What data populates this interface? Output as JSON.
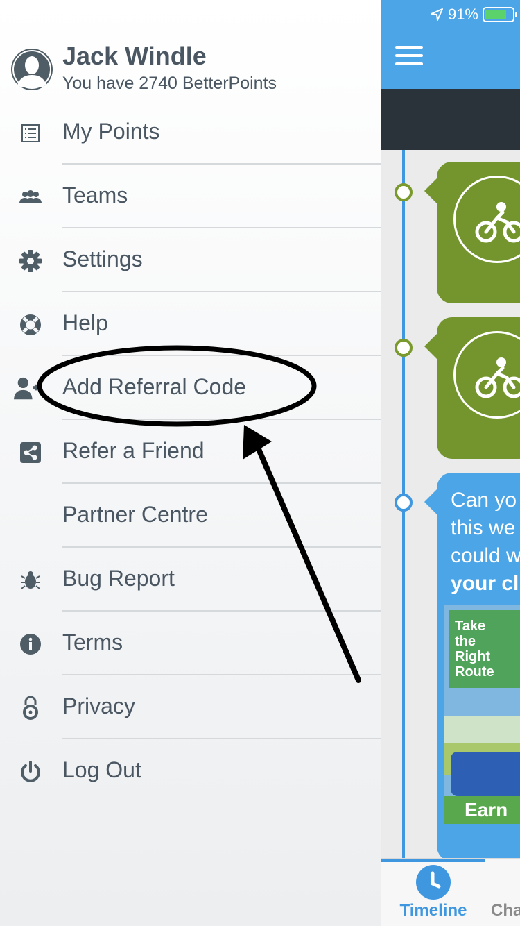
{
  "status": {
    "battery_percent": "91%"
  },
  "profile": {
    "name": "Jack Windle",
    "points_text": "You have 2740 BetterPoints"
  },
  "menu": {
    "items": [
      {
        "label": "My Points",
        "icon": "list-icon"
      },
      {
        "label": "Teams",
        "icon": "team-icon"
      },
      {
        "label": "Settings",
        "icon": "gear-icon"
      },
      {
        "label": "Help",
        "icon": "lifebuoy-icon"
      },
      {
        "label": "Add Referral Code",
        "icon": "add-user-icon"
      },
      {
        "label": "Refer a Friend",
        "icon": "share-icon"
      },
      {
        "label": "Partner Centre",
        "icon": ""
      },
      {
        "label": "Bug Report",
        "icon": "bug-icon"
      },
      {
        "label": "Terms",
        "icon": "info-icon"
      },
      {
        "label": "Privacy",
        "icon": "padlock-icon"
      },
      {
        "label": "Log Out",
        "icon": "power-icon"
      }
    ]
  },
  "app": {
    "promo_lines": [
      "Can yo",
      "this we",
      "could w",
      "your cl"
    ],
    "promo_image_text": [
      "Take",
      "the",
      "Right",
      "Route"
    ],
    "promo_earn": "Earn",
    "tabs": [
      {
        "label": "Timeline",
        "active": true
      },
      {
        "label": "Cha",
        "active": false
      }
    ]
  },
  "colors": {
    "header_blue": "#4ba5e6",
    "card_green": "#74952e",
    "drawer_text": "#4a5762"
  }
}
